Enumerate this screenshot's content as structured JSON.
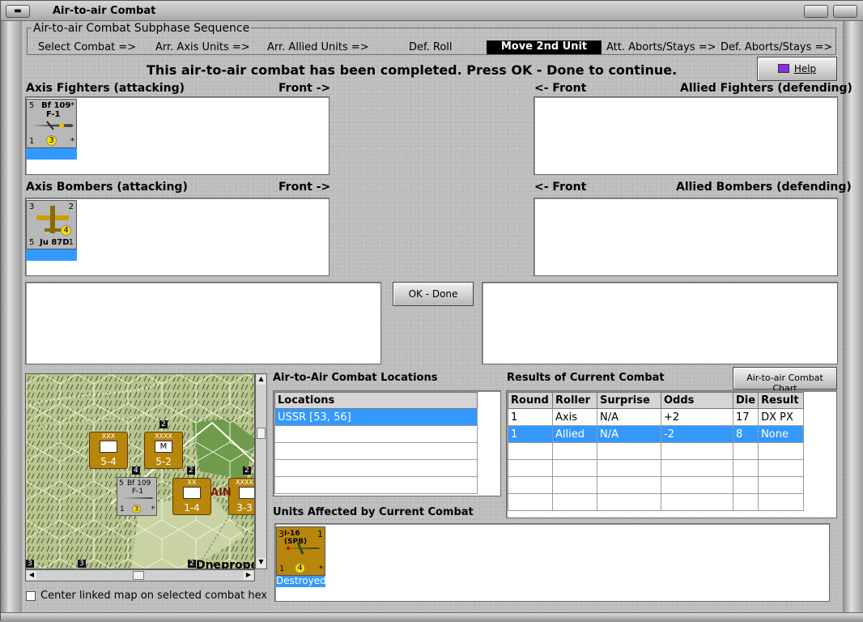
{
  "window": {
    "title": "Air-to-air Combat"
  },
  "sequence": {
    "title": "Air-to-air Combat Subphase Sequence",
    "steps": [
      "Select Combat =>",
      "Arr. Axis Units =>",
      "Arr. Allied Units =>",
      "Def. Roll",
      "Move 2nd Unit",
      "Att. Aborts/Stays =>",
      "Def. Aborts/Stays =>"
    ],
    "active_index": 4
  },
  "message": "This air-to-air combat has been completed.  Press OK - Done to continue.",
  "help_label": "Help",
  "panels": {
    "axis_fighters": "Axis Fighters (attacking)",
    "allied_fighters": "Allied Fighters (defending)",
    "axis_bombers": "Axis Bombers (attacking)",
    "allied_bombers": "Allied Bombers (defending)",
    "front_right": "Front ->",
    "front_left": "<- Front"
  },
  "fighter_counter": {
    "name": "Bf 109",
    "sub": "F-1",
    "tl": "5",
    "bl": "1",
    "coin": "3",
    "tr": "*",
    "br": "*"
  },
  "bomber_counter": {
    "name": "Ju 87D",
    "tl": "3",
    "tr": "2",
    "bl": "5",
    "br": "1",
    "coin": "4"
  },
  "ok_done_label": "OK - Done",
  "locations": {
    "title": "Air-to-Air Combat Locations",
    "header": "Locations",
    "items": [
      "USSR [53, 56]"
    ]
  },
  "results": {
    "title": "Results of Current Combat",
    "chart_button": "Air-to-air Combat Chart",
    "headers": [
      "Round",
      "Roller",
      "Surprise",
      "Odds",
      "Die",
      "Result"
    ],
    "rows": [
      [
        "1",
        "Axis",
        "N/A",
        "+2",
        "17",
        "DX PX"
      ],
      [
        "1",
        "Allied",
        "N/A",
        "-2",
        "8",
        "None"
      ]
    ]
  },
  "affected": {
    "title": "Units Affected by Current Combat",
    "unit_name": "I-16 (SPB)",
    "unit_tl": "3",
    "unit_tr": "1",
    "unit_bl": "1",
    "unit_br": "*",
    "unit_coin": "4",
    "status": "Destroyed"
  },
  "map": {
    "units": [
      {
        "top": "XXX",
        "value": "5-4"
      },
      {
        "top": "XXXX",
        "mark": "M",
        "value": "5-2"
      },
      {
        "top": "XX",
        "value": "1-4"
      },
      {
        "top": "XXXX",
        "value": "3-3"
      }
    ],
    "stack_numbers": [
      "2",
      "4",
      "2",
      "2",
      "3",
      "3",
      "2"
    ],
    "counter": {
      "name": "Bf 109",
      "sub": "F-1",
      "tl": "5",
      "bl": "1",
      "coin": "3",
      "br": "*"
    },
    "place_text": "Dneprope",
    "partial_text": "AIN"
  },
  "center_checkbox_label": "Center linked map on selected combat hex",
  "colors": {
    "selection": "#3399ff",
    "axis_counter": "#b8b8b8",
    "soviet_counter": "#b8860b",
    "coin": "#ffe100"
  }
}
